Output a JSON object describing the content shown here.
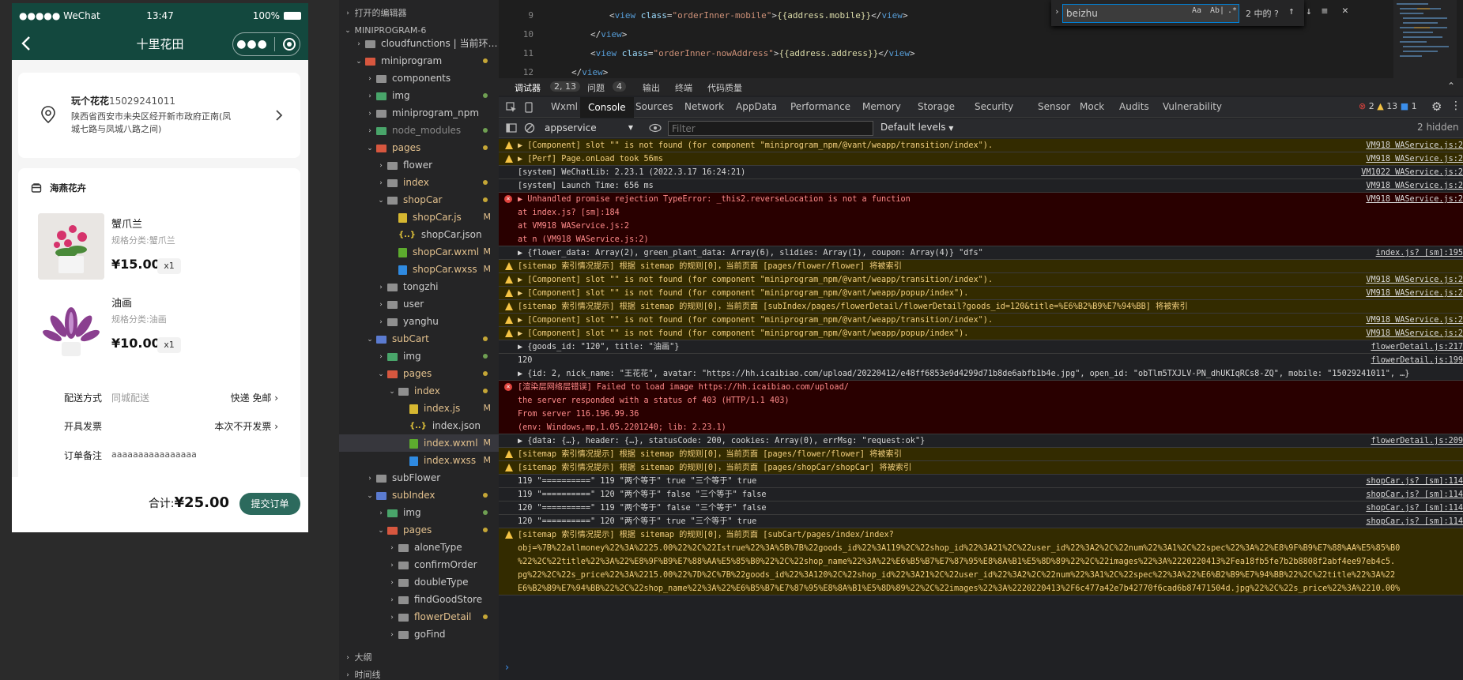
{
  "simulator": {
    "status": {
      "signal": "●●●●● WeChat",
      "time": "13:47",
      "battery": "100%"
    },
    "nav_title": "十里花田",
    "address": {
      "name": "玩个花花",
      "phone": "15029241011",
      "line1": "陕西省西安市未央区经开新市政府正南(凤",
      "line2": "城七路与凤城八路之间)"
    },
    "shop_name": "海燕花卉",
    "products": [
      {
        "name": "蟹爪兰",
        "spec": "规格分类:蟹爪兰",
        "price": "¥15.00",
        "qty": "x1"
      },
      {
        "name": "油画",
        "spec": "规格分类:油画",
        "price": "¥10.00",
        "qty": "x1"
      }
    ],
    "rows": [
      {
        "label": "配送方式",
        "middle": "同城配送",
        "right": "快递 免邮 ›"
      },
      {
        "label": "开具发票",
        "middle": "",
        "right": "本次不开发票 ›"
      },
      {
        "label": "订单备注",
        "middle": "aaaaaaaaaaaaaaaa",
        "right": ""
      }
    ],
    "total_label": "合计:",
    "total_value": "¥25.00",
    "submit": "提交订单"
  },
  "explorer": {
    "open_editors": "打开的编辑器",
    "project": "MINIPROGRAM-6",
    "outline": "大纲",
    "timeline": "时间线",
    "items": [
      {
        "label": "cloudfunctions | 当前环…",
        "icon": "folder",
        "tw": "›",
        "indent": 1,
        "badge": "",
        "dot": ""
      },
      {
        "label": "miniprogram",
        "icon": "red",
        "tw": "⌄",
        "indent": 1,
        "badge": "",
        "dot": "#c5a636"
      },
      {
        "label": "components",
        "icon": "folder",
        "tw": "›",
        "indent": 2,
        "badge": "",
        "dot": ""
      },
      {
        "label": "img",
        "icon": "green",
        "tw": "›",
        "indent": 2,
        "badge": "",
        "dot": "#6f9f52"
      },
      {
        "label": "miniprogram_npm",
        "icon": "folder",
        "tw": "›",
        "indent": 2,
        "badge": "",
        "dot": ""
      },
      {
        "label": "node_modules",
        "icon": "green",
        "tw": "›",
        "indent": 2,
        "badge": "",
        "dot": "#6f9f52",
        "dim": true
      },
      {
        "label": "pages",
        "icon": "red",
        "tw": "⌄",
        "indent": 2,
        "badge": "",
        "dot": "#c5a636",
        "color": "#e2c08d"
      },
      {
        "label": "flower",
        "icon": "folder",
        "tw": "›",
        "indent": 3,
        "badge": "",
        "dot": ""
      },
      {
        "label": "index",
        "icon": "folder",
        "tw": "›",
        "indent": 3,
        "badge": "",
        "dot": "#c5a636",
        "color": "#e2c08d"
      },
      {
        "label": "shopCar",
        "icon": "folder",
        "tw": "⌄",
        "indent": 3,
        "badge": "",
        "dot": "#c5a636",
        "color": "#e2c08d"
      },
      {
        "label": "shopCar.js",
        "icon": "fjs",
        "tw": "",
        "indent": 4,
        "badge": "M",
        "dot": "",
        "color": "#e2c08d"
      },
      {
        "label": "shopCar.json",
        "icon": "fjson",
        "tw": "",
        "indent": 4,
        "badge": "",
        "dot": ""
      },
      {
        "label": "shopCar.wxml",
        "icon": "fwxml",
        "tw": "",
        "indent": 4,
        "badge": "M",
        "dot": "",
        "color": "#e2c08d"
      },
      {
        "label": "shopCar.wxss",
        "icon": "fwxss",
        "tw": "",
        "indent": 4,
        "badge": "M",
        "dot": "",
        "color": "#e2c08d"
      },
      {
        "label": "tongzhi",
        "icon": "folder",
        "tw": "›",
        "indent": 3,
        "badge": "",
        "dot": ""
      },
      {
        "label": "user",
        "icon": "folder",
        "tw": "›",
        "indent": 3,
        "badge": "",
        "dot": ""
      },
      {
        "label": "yanghu",
        "icon": "folder",
        "tw": "›",
        "indent": 3,
        "badge": "",
        "dot": ""
      },
      {
        "label": "subCart",
        "icon": "blue",
        "tw": "⌄",
        "indent": 2,
        "badge": "",
        "dot": "#c5a636",
        "color": "#e2c08d"
      },
      {
        "label": "img",
        "icon": "green",
        "tw": "›",
        "indent": 3,
        "badge": "",
        "dot": "#6f9f52"
      },
      {
        "label": "pages",
        "icon": "red",
        "tw": "⌄",
        "indent": 3,
        "badge": "",
        "dot": "#c5a636",
        "color": "#e2c08d"
      },
      {
        "label": "index",
        "icon": "folder",
        "tw": "⌄",
        "indent": 4,
        "badge": "",
        "dot": "#c5a636",
        "color": "#e2c08d"
      },
      {
        "label": "index.js",
        "icon": "fjs",
        "tw": "",
        "indent": 5,
        "badge": "M",
        "dot": "",
        "color": "#e2c08d"
      },
      {
        "label": "index.json",
        "icon": "fjson",
        "tw": "",
        "indent": 5,
        "badge": "",
        "dot": ""
      },
      {
        "label": "index.wxml",
        "icon": "fwxml",
        "tw": "",
        "indent": 5,
        "badge": "M",
        "dot": "",
        "color": "#e2c08d",
        "selected": true
      },
      {
        "label": "index.wxss",
        "icon": "fwxss",
        "tw": "",
        "indent": 5,
        "badge": "M",
        "dot": "",
        "color": "#e2c08d"
      },
      {
        "label": "subFlower",
        "icon": "folder",
        "tw": "›",
        "indent": 2,
        "badge": "",
        "dot": ""
      },
      {
        "label": "subIndex",
        "icon": "blue",
        "tw": "⌄",
        "indent": 2,
        "badge": "",
        "dot": "#c5a636",
        "color": "#e2c08d"
      },
      {
        "label": "img",
        "icon": "green",
        "tw": "›",
        "indent": 3,
        "badge": "",
        "dot": "#6f9f52"
      },
      {
        "label": "pages",
        "icon": "red",
        "tw": "⌄",
        "indent": 3,
        "badge": "",
        "dot": "#c5a636",
        "color": "#e2c08d"
      },
      {
        "label": "aloneType",
        "icon": "folder",
        "tw": "›",
        "indent": 4,
        "badge": "",
        "dot": ""
      },
      {
        "label": "confirmOrder",
        "icon": "folder",
        "tw": "›",
        "indent": 4,
        "badge": "",
        "dot": ""
      },
      {
        "label": "doubleType",
        "icon": "folder",
        "tw": "›",
        "indent": 4,
        "badge": "",
        "dot": ""
      },
      {
        "label": "findGoodStore",
        "icon": "folder",
        "tw": "›",
        "indent": 4,
        "badge": "",
        "dot": ""
      },
      {
        "label": "flowerDetail",
        "icon": "folder",
        "tw": "›",
        "indent": 4,
        "badge": "",
        "dot": "#c5a636",
        "color": "#e2c08d"
      },
      {
        "label": "goFind",
        "icon": "folder",
        "tw": "›",
        "indent": 4,
        "badge": "",
        "dot": ""
      }
    ]
  },
  "editor": {
    "lines": [
      {
        "no": "9",
        "html": "<span class='br'>&lt;</span><span class='tg'>view</span> <span class='at'>class</span><span class='br'>=</span><span class='st'>\"orderInner-mobile\"</span><span class='br'>&gt;</span><span class='iv'>{{address.mobile}}</span><span class='br'>&lt;/</span><span class='tg'>view</span><span class='br'>&gt;</span>",
        "indent": 80
      },
      {
        "no": "10",
        "html": "<span class='br'>&lt;/</span><span class='tg'>view</span><span class='br'>&gt;</span>",
        "indent": 56
      },
      {
        "no": "11",
        "html": "<span class='br'>&lt;</span><span class='tg'>view</span> <span class='at'>class</span><span class='br'>=</span><span class='st'>\"orderInner-nowAddress\"</span><span class='br'>&gt;</span><span class='iv'>{{address.address}}</span><span class='br'>&lt;/</span><span class='tg'>view</span><span class='br'>&gt;</span>",
        "indent": 56
      },
      {
        "no": "12",
        "html": "<span class='br'>&lt;/</span><span class='tg'>view</span><span class='br'>&gt;</span>",
        "indent": 32
      }
    ],
    "find": {
      "value": "beizhu",
      "matchcase": "Aa",
      "word": "Ab|",
      "regex": ".*",
      "result": "2 中的 ?"
    }
  },
  "devtools": {
    "top": {
      "debugger": "调试器",
      "debugger_count": "2, 13",
      "issues": "问题",
      "issues_count": "4",
      "output": "输出",
      "terminal": "终端",
      "quality": "代码质量"
    },
    "tabs": [
      "Wxml",
      "Console",
      "Sources",
      "Network",
      "AppData",
      "Performance",
      "Memory",
      "Storage",
      "Security",
      "Sensor",
      "Mock",
      "Audits",
      "Vulnerability"
    ],
    "active_tab": "Console",
    "counts": {
      "errors": "2",
      "warnings": "13",
      "info": "1"
    },
    "context": "appservice",
    "filter_placeholder": "Filter",
    "levels": "Default levels",
    "hidden": "2 hidden"
  },
  "console": [
    {
      "type": "warn",
      "h": 17,
      "text": "▶ [Component] slot \"\" is not found (for component \"miniprogram_npm/@vant/weapp/transition/index\").",
      "src": "VM918 WAService.js:2"
    },
    {
      "type": "warn",
      "h": 17,
      "text": "▶ [Perf] Page.onLoad took 56ms",
      "src": "VM918 WAService.js:2"
    },
    {
      "type": "log",
      "h": 17,
      "text": "[system] WeChatLib: 2.23.1 (2022.3.17 16:24:21)",
      "src": "VM1022 WAService.js:2"
    },
    {
      "type": "log",
      "h": 17,
      "text": "[system] Launch Time: 656 ms",
      "src": "VM918 WAService.js:2"
    },
    {
      "type": "err",
      "h": 68,
      "text": "▶ Unhandled promise rejection TypeError: _this2.reverseLocation is not a function",
      "sub": [
        "    at index.js? [sm]:184",
        "    at VM918 WAService.js:2",
        "    at n (VM918 WAService.js:2)",
        "(env: Windows,mp,1.05.2201240; lib: 2.23.1)"
      ],
      "src": "VM918 WAService.js:2"
    },
    {
      "type": "log",
      "h": 17,
      "text": "▶ {flower_data: Array(2), green_plant_data: Array(6), slidies: Array(1), coupon: Array(4)} \"dfs\"",
      "src": "index.js? [sm]:195"
    },
    {
      "type": "warn",
      "h": 17,
      "text": "[sitemap 索引情况提示] 根据 sitemap 的规则[0]，当前页面 [pages/flower/flower] 将被索引",
      "src": ""
    },
    {
      "type": "warn",
      "h": 17,
      "text": "▶ [Component] slot \"\" is not found (for component \"miniprogram_npm/@vant/weapp/transition/index\").",
      "src": "VM918 WAService.js:2"
    },
    {
      "type": "warn",
      "h": 17,
      "text": "▶ [Component] slot \"\" is not found (for component \"miniprogram_npm/@vant/weapp/popup/index\").",
      "src": "VM918 WAService.js:2"
    },
    {
      "type": "warn",
      "h": 17,
      "text": "[sitemap 索引情况提示] 根据 sitemap 的规则[0]，当前页面 [subIndex/pages/flowerDetail/flowerDetail?goods_id=120&title=%E6%B2%B9%E7%94%BB] 将被索引",
      "src": ""
    },
    {
      "type": "warn",
      "h": 17,
      "text": "▶ [Component] slot \"\" is not found (for component \"miniprogram_npm/@vant/weapp/transition/index\").",
      "src": "VM918 WAService.js:2"
    },
    {
      "type": "warn",
      "h": 17,
      "text": "▶ [Component] slot \"\" is not found (for component \"miniprogram_npm/@vant/weapp/popup/index\").",
      "src": "VM918 WAService.js:2"
    },
    {
      "type": "log",
      "h": 17,
      "text": "▶ {goods_id: \"120\", title: \"油画\"}",
      "src": "flowerDetail.js:217"
    },
    {
      "type": "log",
      "h": 34,
      "text": "120",
      "sub": [
        "▶ {id: 2, nick_name: \"王花花\", avatar: \"https://hh.icaibiao.com/upload/20220412/e48ff6853e9d4299d71b8de6abfb1b4e.jpg\", open_id: \"obTlm5TXJLV-PN_dhUKIqRCs8-ZQ\", mobile: \"15029241011\", …}"
      ],
      "src": "flowerDetail.js:199"
    },
    {
      "type": "err",
      "h": 68,
      "text": "[渲染层网络层错误] Failed to load image https://hh.icaibiao.com/upload/",
      "sub": [
        "the server responded with a status of 403 (HTTP/1.1 403)",
        "From server 116.196.99.36",
        "(env: Windows,mp,1.05.2201240; lib: 2.23.1)"
      ],
      "src": ""
    },
    {
      "type": "log",
      "h": 17,
      "text": "▶ {data: {…}, header: {…}, statusCode: 200, cookies: Array(0), errMsg: \"request:ok\"}",
      "src": "flowerDetail.js:209"
    },
    {
      "type": "warn",
      "h": 17,
      "text": "[sitemap 索引情况提示] 根据 sitemap 的规则[0]，当前页面 [pages/flower/flower] 将被索引",
      "src": ""
    },
    {
      "type": "warn",
      "h": 17,
      "text": "[sitemap 索引情况提示] 根据 sitemap 的规则[0]，当前页面 [pages/shopCar/shopCar] 将被索引",
      "src": ""
    },
    {
      "type": "log",
      "h": 17,
      "text": "119 \"==========\" 119 \"两个等于\" true \"三个等于\" true",
      "src": "shopCar.js? [sm]:114"
    },
    {
      "type": "log",
      "h": 17,
      "text": "119 \"==========\" 120 \"两个等于\" false \"三个等于\" false",
      "src": "shopCar.js? [sm]:114"
    },
    {
      "type": "log",
      "h": 17,
      "text": "120 \"==========\" 119 \"两个等于\" false \"三个等于\" false",
      "src": "shopCar.js? [sm]:114"
    },
    {
      "type": "log",
      "h": 17,
      "text": "120 \"==========\" 120 \"两个等于\" true \"三个等于\" true",
      "src": "shopCar.js? [sm]:114"
    },
    {
      "type": "warn",
      "h": 85,
      "text": "[sitemap 索引情况提示] 根据 sitemap 的规则[0]，当前页面 [subCart/pages/index/index?",
      "sub": [
        "obj=%7B%22allmoney%22%3A%2225.00%22%2C%22Istrue%22%3A%5B%7B%22goods_id%22%3A119%2C%22shop_id%22%3A21%2C%22user_id%22%3A2%2C%22num%22%3A1%2C%22spec%22%3A%22%E8%9F%B9%E7%88%AA%E5%85%B0",
        "%22%2C%22title%22%3A%22%E8%9F%B9%E7%88%AA%E5%85%B0%22%2C%22shop_name%22%3A%22%E6%B5%B7%E7%87%95%E8%8A%B1%E5%8D%89%22%2C%22images%22%3A%2220220413%2Fea18fb5fe7b2b8808f2abf4ee97eb4c5.",
        "pg%22%2C%22s_price%22%3A%2215.00%22%7D%2C%7B%22goods_id%22%3A120%2C%22shop_id%22%3A21%2C%22user_id%22%3A2%2C%22num%22%3A1%2C%22spec%22%3A%22%E6%B2%B9%E7%94%BB%22%2C%22title%22%3A%22",
        "E6%B2%B9%E7%94%BB%22%2C%22shop_name%22%3A%22%E6%B5%B7%E7%87%95%E8%8A%B1%E5%8D%89%22%2C%22images%22%3A%2220220413%2F6c477a42e7b42770f6cad6b87471504d.jpg%22%2C%22s_price%22%3A%2210.00%",
        "22%7D%5D%7D] 将被索引"
      ],
      "src": ""
    }
  ],
  "colors": {
    "brand": "#13483e",
    "panel": "#252526",
    "editor": "#1e1e1e",
    "warn_bg": "#332b00",
    "err_bg": "#290000"
  }
}
